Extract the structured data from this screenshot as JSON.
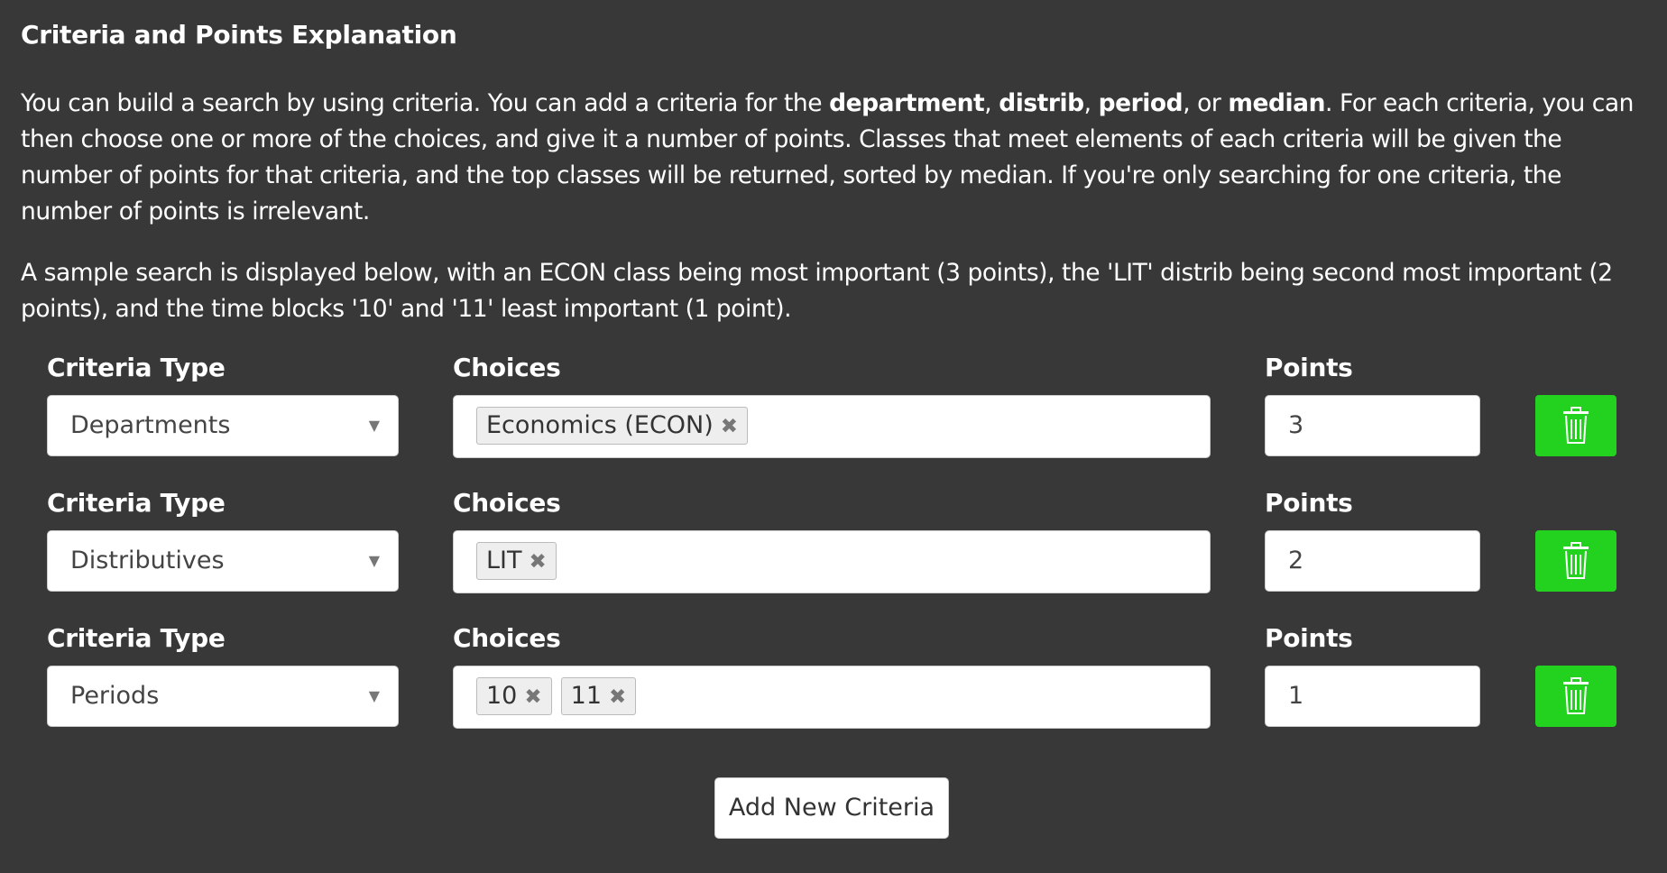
{
  "title": "Criteria and Points Explanation",
  "intro": {
    "p1_a": "You can build a search by using criteria. You can add a criteria for the ",
    "b1": "department",
    "sep1": ", ",
    "b2": "distrib",
    "sep2": ", ",
    "b3": "period",
    "sep3": ", or ",
    "b4": "median",
    "p1_b": ". For each criteria, you can then choose one or more of the choices, and give it a number of points. Classes that meet elements of each criteria will be given the number of points for that criteria, and the top classes will be returned, sorted by median. If you're only searching for one criteria, the number of points is irrelevant.",
    "p2": "A sample search is displayed below, with an ECON class being most important (3 points), the 'LIT' distrib being second most important (2 points), and the time blocks '10' and '11' least important (1 point)."
  },
  "labels": {
    "criteria_type": "Criteria Type",
    "choices": "Choices",
    "points": "Points"
  },
  "criteria": [
    {
      "type": "Departments",
      "choices": [
        "Economics (ECON)"
      ],
      "points": "3"
    },
    {
      "type": "Distributives",
      "choices": [
        "LIT"
      ],
      "points": "2"
    },
    {
      "type": "Periods",
      "choices": [
        "10",
        "11"
      ],
      "points": "1"
    }
  ],
  "tag_remove_glyph": "✖",
  "select_arrow_glyph": "▼",
  "icons": {
    "delete": "trash-icon"
  },
  "colors": {
    "background": "#383838",
    "delete_button": "#22d21f"
  },
  "add_button_label": "Add New Criteria"
}
